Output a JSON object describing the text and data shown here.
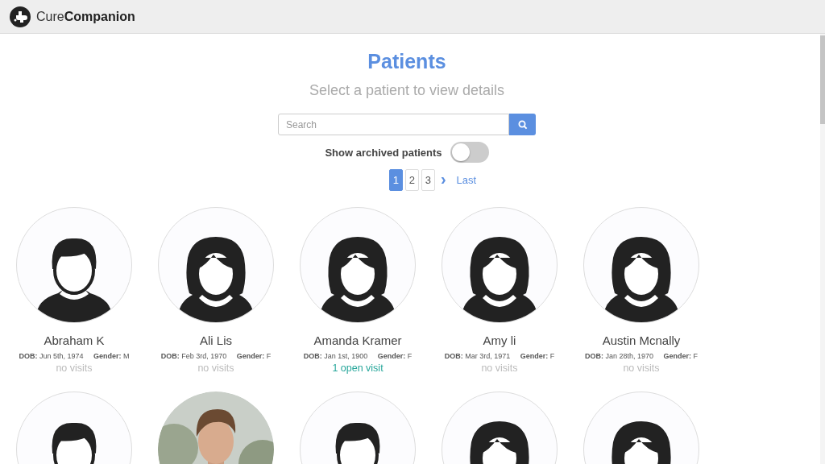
{
  "brand": {
    "light": "Cure",
    "bold": "Companion"
  },
  "title": "Patients",
  "subtitle": "Select a patient to view details",
  "search": {
    "placeholder": "Search"
  },
  "archived_toggle": {
    "label": "Show archived patients",
    "on": false
  },
  "pagination": {
    "pages": [
      {
        "label": "1",
        "selected": true
      },
      {
        "label": "2",
        "selected": false
      },
      {
        "label": "3",
        "selected": false
      }
    ],
    "next": "›",
    "last": "Last"
  },
  "patients": [
    {
      "kind": "male",
      "name": "Abraham K",
      "dob_label": "DOB:",
      "dob": "Jun 5th, 1974",
      "gender_label": "Gender:",
      "gender": "M",
      "visits": {
        "text": "no visits",
        "kind": "none"
      }
    },
    {
      "kind": "female",
      "name": "Ali Lis",
      "dob_label": "DOB:",
      "dob": "Feb 3rd, 1970",
      "gender_label": "Gender:",
      "gender": "F",
      "visits": {
        "text": "no visits",
        "kind": "none"
      }
    },
    {
      "kind": "female",
      "name": "Amanda Kramer",
      "dob_label": "DOB:",
      "dob": "Jan 1st, 1900",
      "gender_label": "Gender:",
      "gender": "F",
      "visits": {
        "text": "1 open visit",
        "kind": "open"
      }
    },
    {
      "kind": "female",
      "name": "Amy li",
      "dob_label": "DOB:",
      "dob": "Mar 3rd, 1971",
      "gender_label": "Gender:",
      "gender": "F",
      "visits": {
        "text": "no visits",
        "kind": "none"
      }
    },
    {
      "kind": "female",
      "name": "Austin Mcnally",
      "dob_label": "DOB:",
      "dob": "Jan 28th, 1970",
      "gender_label": "Gender:",
      "gender": "F",
      "visits": {
        "text": "no visits",
        "kind": "none"
      }
    },
    {
      "kind": "male"
    },
    {
      "kind": "picture"
    },
    {
      "kind": "male"
    },
    {
      "kind": "female"
    },
    {
      "kind": "female"
    }
  ]
}
